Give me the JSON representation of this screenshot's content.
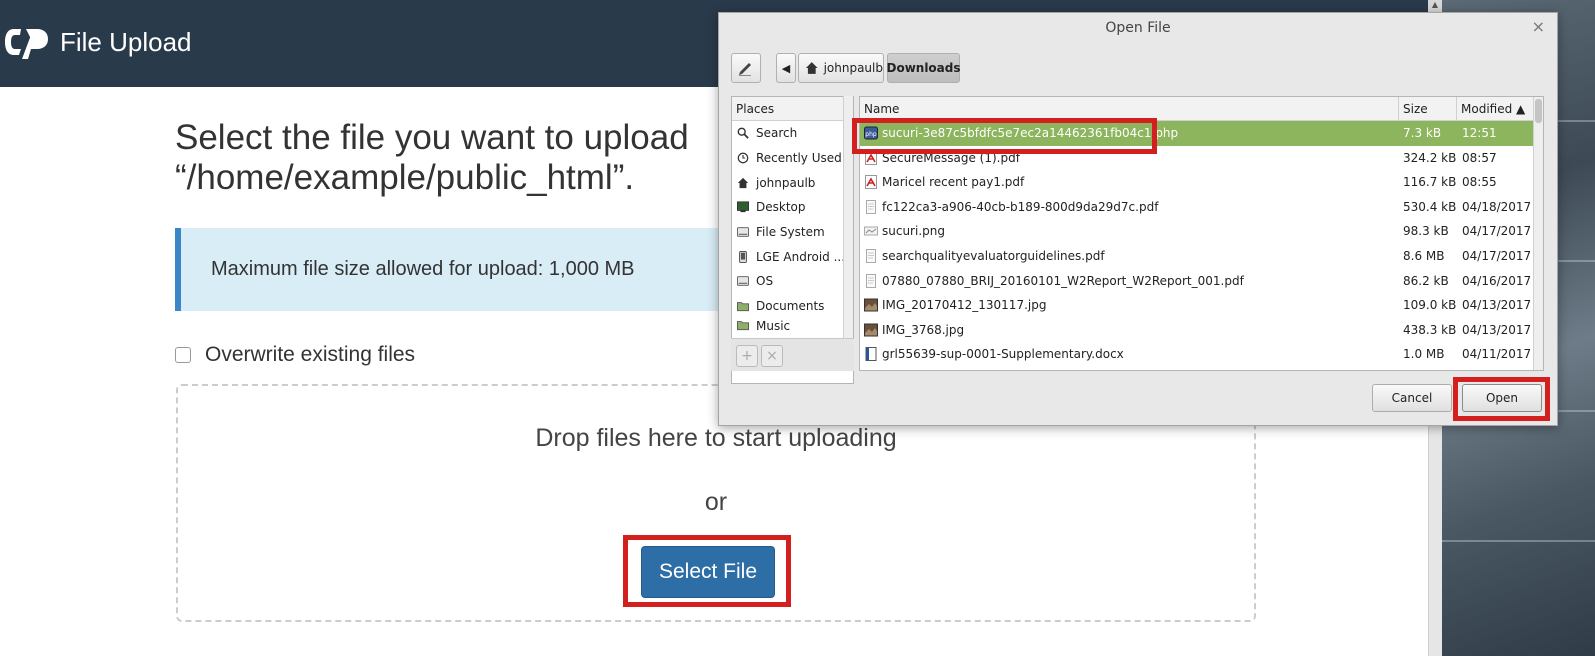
{
  "header": {
    "logo": "cP",
    "title": "File Upload"
  },
  "main": {
    "heading_line1": "Select the file you want to upload",
    "heading_line2": "“/home/example/public_html”.",
    "max_size_notice": "Maximum file size allowed for upload: 1,000 MB",
    "overwrite_label": "Overwrite existing files",
    "drop_text": "Drop files here to start uploading",
    "or_text": "or",
    "select_button": "Select File"
  },
  "dialog": {
    "title": "Open File",
    "close": "×",
    "breadcrumb": [
      "johnpaulb",
      "Downloads"
    ],
    "places_header": "Places",
    "places": [
      {
        "label": "Search",
        "icon": "search-icon"
      },
      {
        "label": "Recently Used",
        "icon": "clock-icon"
      },
      {
        "label": "johnpaulb",
        "icon": "home-icon"
      },
      {
        "label": "Desktop",
        "icon": "desktop-icon"
      },
      {
        "label": "File System",
        "icon": "drive-icon"
      },
      {
        "label": "LGE Android ...",
        "icon": "phone-icon"
      },
      {
        "label": "OS",
        "icon": "drive-icon"
      },
      {
        "label": "Documents",
        "icon": "folder-icon"
      },
      {
        "label": "Music",
        "icon": "folder-icon"
      }
    ],
    "columns": {
      "name": "Name",
      "size": "Size",
      "modified": "Modified ▲"
    },
    "files": [
      {
        "name": "sucuri-3e87c5bfdfc5e7ec2a14462361fb04c1.php",
        "size": "7.3 kB",
        "modified": "12:51",
        "icon": "php-file-icon",
        "selected": true
      },
      {
        "name": "SecureMessage (1).pdf",
        "size": "324.2 kB",
        "modified": "08:57",
        "icon": "pdf-file-icon"
      },
      {
        "name": "Maricel recent pay1.pdf",
        "size": "116.7 kB",
        "modified": "08:55",
        "icon": "pdf-file-icon"
      },
      {
        "name": "fc122ca3-a906-40cb-b189-800d9da29d7c.pdf",
        "size": "530.4 kB",
        "modified": "04/18/2017",
        "icon": "generic-file-icon"
      },
      {
        "name": "sucuri.png",
        "size": "98.3 kB",
        "modified": "04/17/2017",
        "icon": "image-file-icon"
      },
      {
        "name": "searchqualityevaluatorguidelines.pdf",
        "size": "8.6 MB",
        "modified": "04/17/2017",
        "icon": "generic-file-icon"
      },
      {
        "name": "07880_07880_BRIJ_20160101_W2Report_W2Report_001.pdf",
        "size": "86.2 kB",
        "modified": "04/16/2017",
        "icon": "generic-file-icon"
      },
      {
        "name": "IMG_20170412_130117.jpg",
        "size": "109.0 kB",
        "modified": "04/13/2017",
        "icon": "photo-file-icon"
      },
      {
        "name": "IMG_3768.jpg",
        "size": "438.3 kB",
        "modified": "04/13/2017",
        "icon": "photo-file-icon"
      },
      {
        "name": "grl55639-sup-0001-Supplementary.docx",
        "size": "1.0 MB",
        "modified": "04/11/2017",
        "icon": "doc-file-icon"
      }
    ],
    "add_place": "+",
    "remove_place": "×",
    "cancel": "Cancel",
    "open": "Open"
  },
  "colors": {
    "header_bg": "#293a4a",
    "selection": "#8cb55d",
    "primary_button": "#2e6ea6",
    "highlight": "#d41f1f",
    "info_bg": "#d9edf7"
  }
}
